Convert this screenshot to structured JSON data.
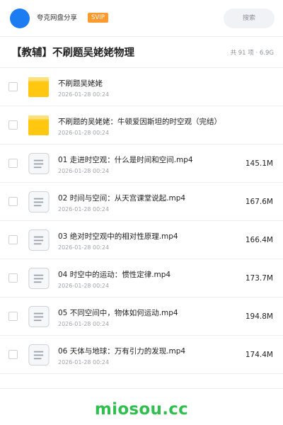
{
  "header": {
    "share_name": "夸克网盘分享",
    "badge": "SVIP",
    "search_placeholder": "搜索",
    "accent_color": "#1e7cf2",
    "badge_color": "#ff9a2e"
  },
  "folder": {
    "title": "【教辅】不刷题吴姥姥物理",
    "count_info": "共 91 项 · 6.9G"
  },
  "files": [
    {
      "type": "folder",
      "icon": "folder-icon",
      "name": "不刷题吴姥姥",
      "date": "2026-01-28 00:24",
      "size": ""
    },
    {
      "type": "folder",
      "icon": "folder-icon",
      "name": "不刷题的吴姥姥：牛顿爱因斯坦的时空观（完结）",
      "date": "2026-01-28 00:24",
      "size": ""
    },
    {
      "type": "file",
      "icon": "document-icon",
      "name": "01 走进时空观：什么是时间和空间.mp4",
      "date": "2026-01-28 00:24",
      "size": "145.1M"
    },
    {
      "type": "file",
      "icon": "document-icon",
      "name": "02 时间与空间：从天宫课堂说起.mp4",
      "date": "2026-01-28 00:24",
      "size": "167.6M"
    },
    {
      "type": "file",
      "icon": "document-icon",
      "name": "03 绝对时空观中的相对性原理.mp4",
      "date": "2026-01-28 00:24",
      "size": "166.4M"
    },
    {
      "type": "file",
      "icon": "document-icon",
      "name": "04 时空中的运动：惯性定律.mp4",
      "date": "2026-01-28 00:24",
      "size": "173.7M"
    },
    {
      "type": "file",
      "icon": "document-icon",
      "name": "05 不同空间中，物体如何运动.mp4",
      "date": "2026-01-28 00:24",
      "size": "194.8M"
    },
    {
      "type": "file",
      "icon": "document-icon",
      "name": "06 天体与地球：万有引力的发现.mp4",
      "date": "2026-01-28 00:24",
      "size": "174.4M"
    }
  ],
  "footer": {
    "watermark": "miosou.cc",
    "watermark_color": "#2fbf4f"
  }
}
